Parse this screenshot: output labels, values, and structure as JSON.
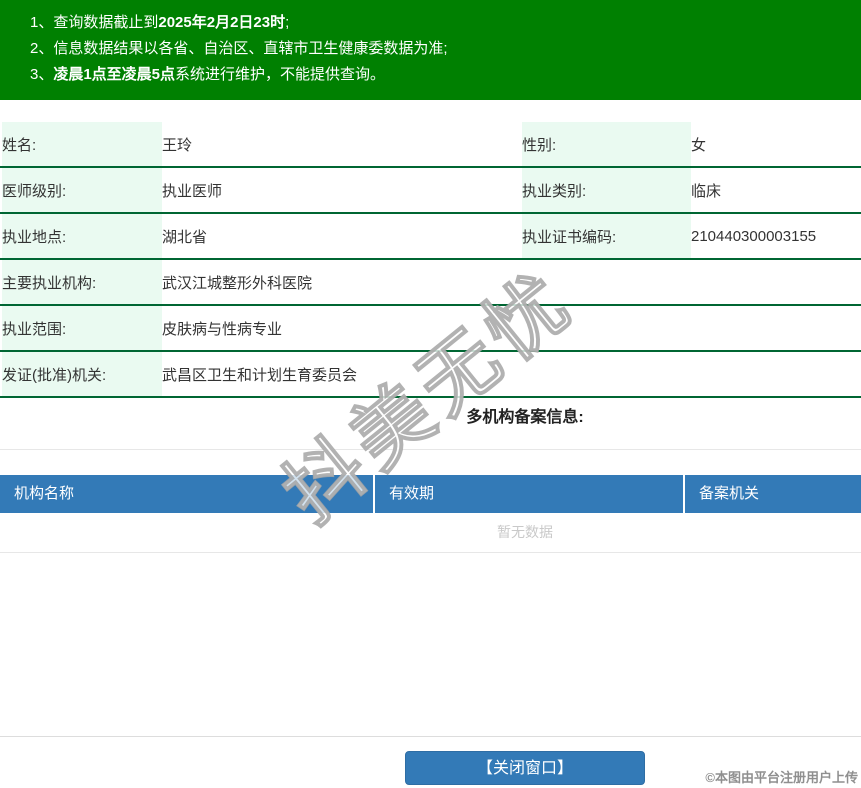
{
  "banner": {
    "notices": [
      {
        "num": "1、",
        "pre": "查询数据截止到",
        "bold": "2025年2月2日23时",
        "post": ";"
      },
      {
        "num": "2、",
        "pre": "信息数据结果以各省、自治区、直辖市卫生健康委数据为准;",
        "bold": "",
        "post": ""
      },
      {
        "num": "3、",
        "pre": "",
        "bold": "凌晨1点至凌晨5点",
        "post": "系统进行维护，不能提供查询。"
      }
    ]
  },
  "info": {
    "rows4": [
      {
        "l1": "姓名:",
        "v1": "王玲",
        "l2": "性别:",
        "v2": "女"
      },
      {
        "l1": "医师级别:",
        "v1": "执业医师",
        "l2": "执业类别:",
        "v2": "临床"
      },
      {
        "l1": "执业地点:",
        "v1": "湖北省",
        "l2": "执业证书编码:",
        "v2": "210440300003155"
      }
    ],
    "rows2": [
      {
        "l": "主要执业机构:",
        "v": "武汉江城整形外科医院"
      },
      {
        "l": "执业范围:",
        "v": "皮肤病与性病专业"
      },
      {
        "l": "发证(批准)机关:",
        "v": "武昌区卫生和计划生育委员会"
      }
    ]
  },
  "multi": {
    "title": "多机构备案信息:",
    "headers": [
      "机构名称",
      "有效期",
      "备案机关"
    ],
    "empty_text": "暂无数据"
  },
  "close_button_label": "【关闭窗口】",
  "footer_stamp": "©本图由平台注册用户上传",
  "watermark_text": "抖美无忧",
  "colors": {
    "banner_green": "#008001",
    "row_border_green": "#006633",
    "label_bg_mint": "#eafaf1",
    "header_blue": "#337ab7",
    "empty_text_gray": "#c9c9c9"
  }
}
